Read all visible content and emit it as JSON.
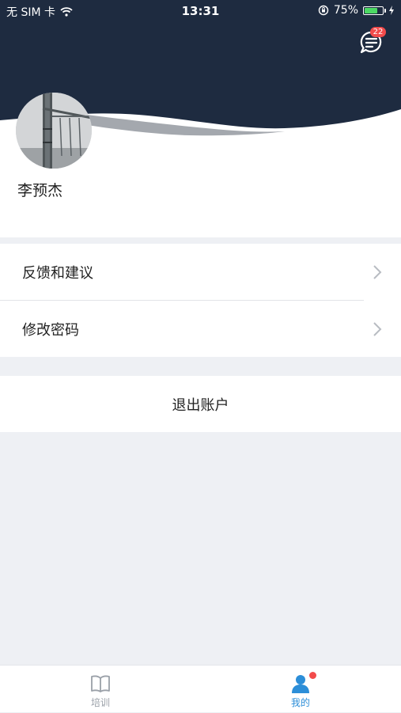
{
  "status_bar": {
    "carrier": "无 SIM 卡",
    "time": "13:31",
    "battery_percent": "75%",
    "battery_level": 0.75,
    "wifi_icon": "wifi-icon",
    "orientation_lock_icon": "orientation-lock-icon",
    "charging_icon": "charging-bolt-icon"
  },
  "header": {
    "message_badge": "22",
    "message_icon": "chat-bubble-icon",
    "background_color": "#1e2b40"
  },
  "profile": {
    "name": "李预杰"
  },
  "menu": {
    "items": [
      {
        "label": "反馈和建议"
      },
      {
        "label": "修改密码"
      }
    ]
  },
  "logout": {
    "label": "退出账户"
  },
  "tabbar": {
    "tabs": [
      {
        "label": "培训",
        "icon": "book-icon",
        "active": false
      },
      {
        "label": "我的",
        "icon": "person-icon",
        "active": true
      }
    ],
    "active_color": "#2c8ed8",
    "inactive_color": "#9aa0a8"
  }
}
